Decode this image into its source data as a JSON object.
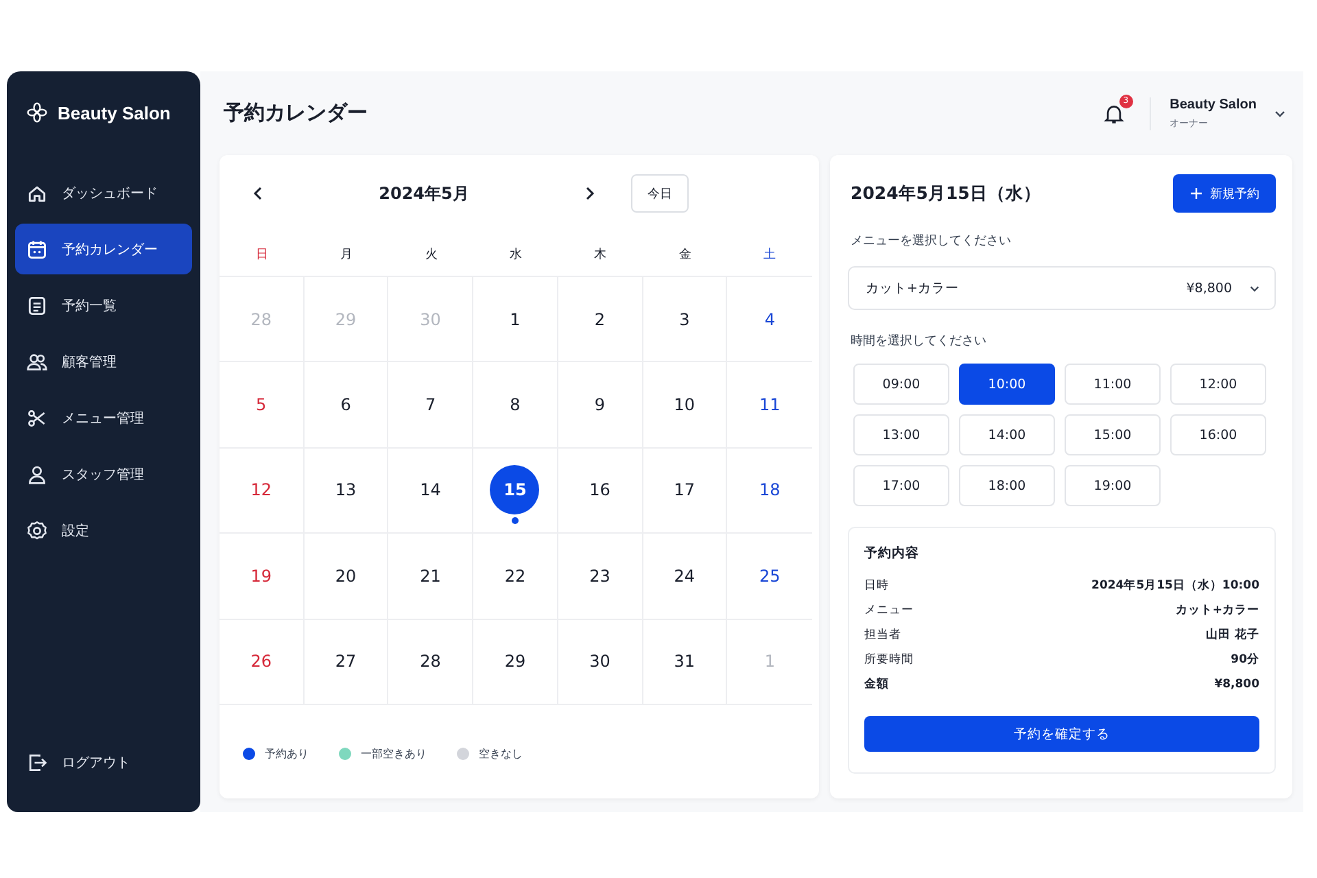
{
  "sidebar": {
    "brand": "Beauty Salon",
    "items": [
      {
        "label": "ダッシュボード",
        "selected": false
      },
      {
        "label": "予約カレンダー",
        "selected": true
      },
      {
        "label": "予約一覧",
        "selected": false
      },
      {
        "label": "顧客管理",
        "selected": false
      },
      {
        "label": "メニュー管理",
        "selected": false
      },
      {
        "label": "スタッフ管理",
        "selected": false
      },
      {
        "label": "設定",
        "selected": false
      }
    ],
    "logout": "ログアウト"
  },
  "header": {
    "title": "予約カレンダー",
    "notification_count": "3",
    "user_name": "Beauty Salon",
    "user_role": "オーナー"
  },
  "calendar": {
    "month": "2024年5月",
    "today_button": "今日",
    "weekdays": [
      {
        "label": "日",
        "color": "#d62839"
      },
      {
        "label": "月",
        "color": "#1a1f2c"
      },
      {
        "label": "火",
        "color": "#1a1f2c"
      },
      {
        "label": "水",
        "color": "#1a1f2c"
      },
      {
        "label": "木",
        "color": "#1a1f2c"
      },
      {
        "label": "金",
        "color": "#1a1f2c"
      },
      {
        "label": "土",
        "color": "#1a47d6"
      }
    ],
    "days": [
      {
        "label": "28",
        "muted": true,
        "selected": false,
        "booked": false
      },
      {
        "label": "29",
        "muted": true,
        "selected": false,
        "booked": false
      },
      {
        "label": "30",
        "muted": true,
        "selected": false,
        "booked": false
      },
      {
        "label": "1",
        "muted": false,
        "selected": false,
        "booked": false
      },
      {
        "label": "2",
        "muted": false,
        "selected": false,
        "booked": false
      },
      {
        "label": "3",
        "muted": false,
        "selected": false,
        "booked": false
      },
      {
        "label": "4",
        "muted": false,
        "selected": false,
        "booked": false
      },
      {
        "label": "5",
        "muted": false,
        "selected": false,
        "booked": false
      },
      {
        "label": "6",
        "muted": false,
        "selected": false,
        "booked": false
      },
      {
        "label": "7",
        "muted": false,
        "selected": false,
        "booked": false
      },
      {
        "label": "8",
        "muted": false,
        "selected": false,
        "booked": false
      },
      {
        "label": "9",
        "muted": false,
        "selected": false,
        "booked": false
      },
      {
        "label": "10",
        "muted": false,
        "selected": false,
        "booked": false
      },
      {
        "label": "11",
        "muted": false,
        "selected": false,
        "booked": false
      },
      {
        "label": "12",
        "muted": false,
        "selected": false,
        "booked": false
      },
      {
        "label": "13",
        "muted": false,
        "selected": false,
        "booked": false
      },
      {
        "label": "14",
        "muted": false,
        "selected": false,
        "booked": false
      },
      {
        "label": "15",
        "muted": false,
        "selected": true,
        "booked": true
      },
      {
        "label": "16",
        "muted": false,
        "selected": false,
        "booked": false
      },
      {
        "label": "17",
        "muted": false,
        "selected": false,
        "booked": false
      },
      {
        "label": "18",
        "muted": false,
        "selected": false,
        "booked": false
      },
      {
        "label": "19",
        "muted": false,
        "selected": false,
        "booked": false
      },
      {
        "label": "20",
        "muted": false,
        "selected": false,
        "booked": false
      },
      {
        "label": "21",
        "muted": false,
        "selected": false,
        "booked": false
      },
      {
        "label": "22",
        "muted": false,
        "selected": false,
        "booked": false
      },
      {
        "label": "23",
        "muted": false,
        "selected": false,
        "booked": false
      },
      {
        "label": "24",
        "muted": false,
        "selected": false,
        "booked": false
      },
      {
        "label": "25",
        "muted": false,
        "selected": false,
        "booked": false
      },
      {
        "label": "26",
        "muted": false,
        "selected": false,
        "booked": false
      },
      {
        "label": "27",
        "muted": false,
        "selected": false,
        "booked": false
      },
      {
        "label": "28",
        "muted": false,
        "selected": false,
        "booked": false
      },
      {
        "label": "29",
        "muted": false,
        "selected": false,
        "booked": false
      },
      {
        "label": "30",
        "muted": false,
        "selected": false,
        "booked": false
      },
      {
        "label": "31",
        "muted": false,
        "selected": false,
        "booked": false
      },
      {
        "label": "1",
        "muted": true,
        "selected": false,
        "booked": false
      }
    ],
    "legend": [
      {
        "label": "予約あり",
        "color": "#0b4ae6"
      },
      {
        "label": "一部空きあり",
        "color": "#7fd8be"
      },
      {
        "label": "空きなし",
        "color": "#d3d5db"
      }
    ]
  },
  "booking": {
    "date_title": "2024年5月15日（水）",
    "new_button": "新規予約",
    "menu_label": "メニューを選択してください",
    "menu_select": {
      "value": "カット+カラー",
      "price": "¥8,800"
    },
    "time_label": "時間を選択してください",
    "times": [
      {
        "label": "09:00",
        "selected": false
      },
      {
        "label": "10:00",
        "selected": true
      },
      {
        "label": "11:00",
        "selected": false
      },
      {
        "label": "12:00",
        "selected": false
      },
      {
        "label": "13:00",
        "selected": false
      },
      {
        "label": "14:00",
        "selected": false
      },
      {
        "label": "15:00",
        "selected": false
      },
      {
        "label": "16:00",
        "selected": false
      },
      {
        "label": "17:00",
        "selected": false
      },
      {
        "label": "18:00",
        "selected": false
      },
      {
        "label": "19:00",
        "selected": false
      }
    ],
    "summary": {
      "title": "予約内容",
      "rows": [
        {
          "label": "日時",
          "value": "2024年5月15日（水）10:00",
          "emphasis": false
        },
        {
          "label": "メニュー",
          "value": "カット+カラー",
          "emphasis": false
        },
        {
          "label": "担当者",
          "value": "山田 花子",
          "emphasis": false
        },
        {
          "label": "所要時間",
          "value": "90分",
          "emphasis": false
        },
        {
          "label": "金額",
          "value": "¥8,800",
          "emphasis": true
        }
      ]
    },
    "confirm_button": "予約を確定する"
  }
}
